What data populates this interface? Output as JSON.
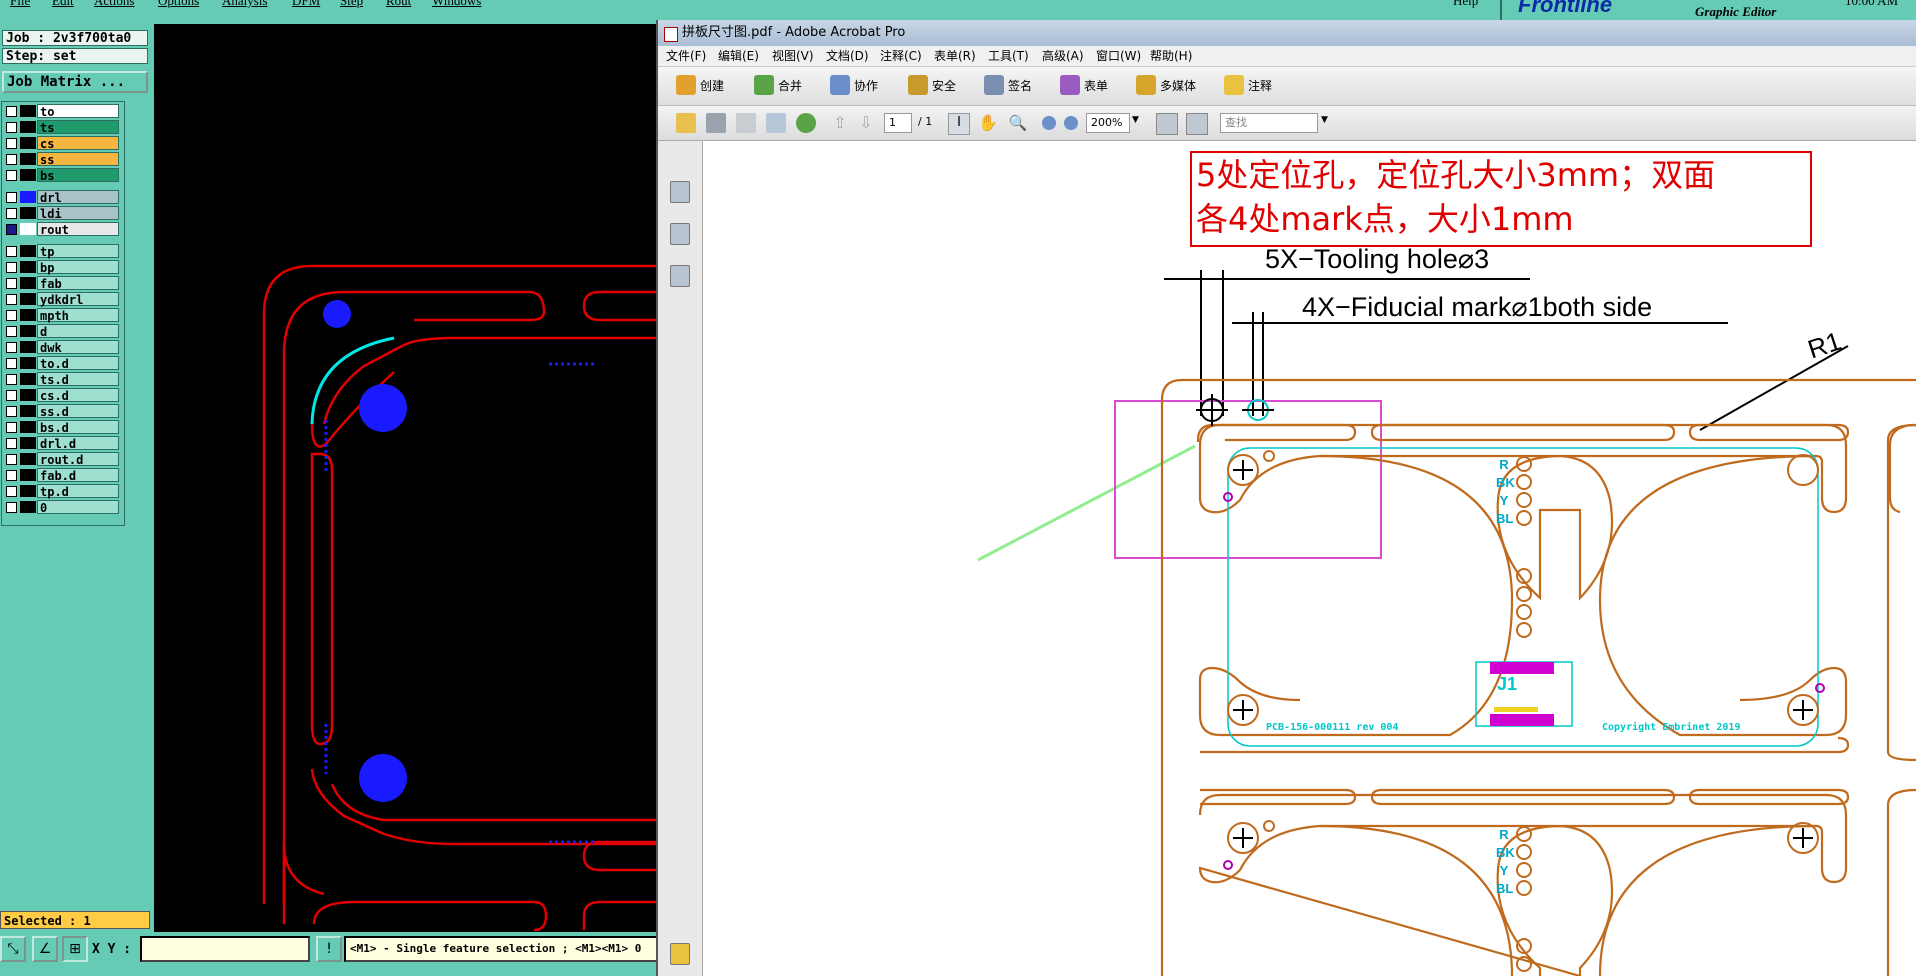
{
  "genesis": {
    "menu": [
      "File",
      "Edit",
      "Actions",
      "Options",
      "Analysis",
      "DFM",
      "Step",
      "Rout",
      "Windows"
    ],
    "help": "Help",
    "brand": "Frontline",
    "subtitle": "Graphic Editor",
    "clock": "10:00 AM",
    "job": "Job : 2v3f700ta0",
    "step": "Step: set",
    "matrix_button": "Job Matrix ...",
    "layers": [
      {
        "name": "to",
        "bg": "#ffffff"
      },
      {
        "name": "ts",
        "bg": "#1f9a6c"
      },
      {
        "name": "cs",
        "bg": "#f6b640"
      },
      {
        "name": "ss",
        "bg": "#f6b640"
      },
      {
        "name": "bs",
        "bg": "#1f9a6c"
      },
      {
        "name": "drl",
        "bg": "#a8c4c8"
      },
      {
        "name": "ldi",
        "bg": "#a8c4c8"
      },
      {
        "name": "rout",
        "bg": "#e8e8e8"
      },
      {
        "name": "tp",
        "bg": "#9fdfcf"
      },
      {
        "name": "bp",
        "bg": "#9fdfcf"
      },
      {
        "name": "fab",
        "bg": "#9fdfcf"
      },
      {
        "name": "ydkdrl",
        "bg": "#9fdfcf"
      },
      {
        "name": "mpth",
        "bg": "#9fdfcf"
      },
      {
        "name": "d",
        "bg": "#9fdfcf"
      },
      {
        "name": "dwk",
        "bg": "#9fdfcf"
      },
      {
        "name": "to.d",
        "bg": "#9fdfcf"
      },
      {
        "name": "ts.d",
        "bg": "#9fdfcf"
      },
      {
        "name": "cs.d",
        "bg": "#9fdfcf"
      },
      {
        "name": "ss.d",
        "bg": "#9fdfcf"
      },
      {
        "name": "bs.d",
        "bg": "#9fdfcf"
      },
      {
        "name": "drl.d",
        "bg": "#9fdfcf"
      },
      {
        "name": "rout.d",
        "bg": "#9fdfcf"
      },
      {
        "name": "fab.d",
        "bg": "#9fdfcf"
      },
      {
        "name": "tp.d",
        "bg": "#9fdfcf"
      },
      {
        "name": "0",
        "bg": "#9fdfcf"
      }
    ],
    "selected": "Selected : 1",
    "xy_label": "X Y :",
    "xy_value": "",
    "prompt": "<M1> - Single feature selection ; <M1><M1> 0"
  },
  "acrobat": {
    "title": "拼板尺寸图.pdf - Adobe Acrobat Pro",
    "menu": [
      "文件(F)",
      "编辑(E)",
      "视图(V)",
      "文档(D)",
      "注释(C)",
      "表单(R)",
      "工具(T)",
      "高级(A)",
      "窗口(W)",
      "帮助(H)"
    ],
    "tasks": [
      "创建",
      "合并",
      "协作",
      "安全",
      "签名",
      "表单",
      "多媒体",
      "注释"
    ],
    "page_current": "1",
    "page_total": "/ 1",
    "zoom": "200%",
    "search_placeholder": "查找"
  },
  "drawing": {
    "note_line1": "5处定位孔，定位孔大小3mm；双面",
    "note_line2": "各4处mark点，大小1mm",
    "dim1": "5X−Tooling hole⌀3",
    "dim2": "4X−Fiducial mark⌀1both side",
    "radius": "R1",
    "silk_left": "PCB-156-000111 rev 004",
    "silk_right": "Copyright Embrinet 2019",
    "connector_label": "J1",
    "pin_letters": [
      "R",
      "BK",
      "Y",
      "BL"
    ]
  },
  "colors": {
    "genesis_bg": "#66cbb4",
    "rout": "#e00000",
    "board": "#c06a1e",
    "silk": "#00c8c8",
    "note_red": "#e00000",
    "selection_box": "#d94bd0",
    "arrow_green": "#90ee90"
  }
}
